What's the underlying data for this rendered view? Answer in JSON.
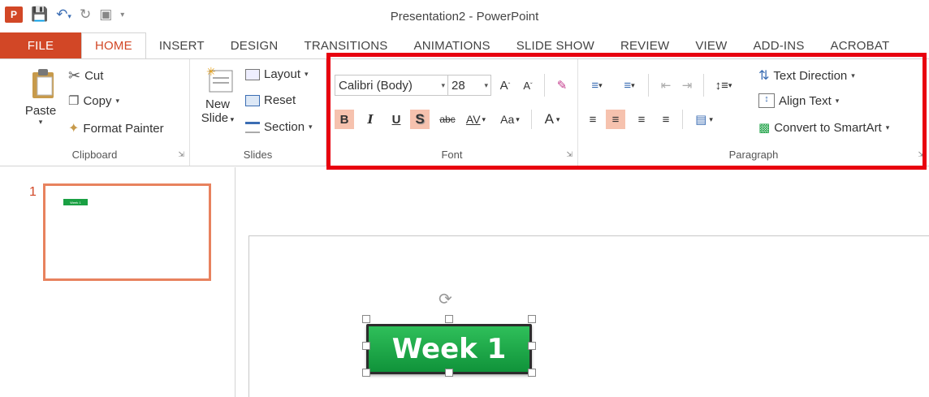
{
  "window": {
    "title": "Presentation2 - PowerPoint"
  },
  "qat": {
    "logo": "P",
    "save_icon": "save-icon",
    "undo_icon": "undo-icon",
    "redo_icon": "redo-icon",
    "present_icon": "presentation-icon"
  },
  "tabs": [
    "FILE",
    "HOME",
    "INSERT",
    "DESIGN",
    "TRANSITIONS",
    "ANIMATIONS",
    "SLIDE SHOW",
    "REVIEW",
    "VIEW",
    "ADD-INS",
    "ACROBAT"
  ],
  "active_tab": "HOME",
  "clipboard": {
    "paste_label": "Paste",
    "cut_label": "Cut",
    "copy_label": "Copy",
    "format_painter_label": "Format Painter",
    "group_label": "Clipboard"
  },
  "slides": {
    "new_slide_label_1": "New",
    "new_slide_label_2": "Slide",
    "layout_label": "Layout",
    "reset_label": "Reset",
    "section_label": "Section",
    "group_label": "Slides"
  },
  "font": {
    "font_name": "Calibri (Body)",
    "font_size": "28",
    "grow_label": "A",
    "shrink_label": "A",
    "bold_label": "B",
    "italic_label": "I",
    "underline_label": "U",
    "shadow_label": "S",
    "strike_label": "abc",
    "spacing_label": "AV",
    "case_label": "Aa",
    "color_label": "A",
    "group_label": "Font"
  },
  "paragraph": {
    "text_direction_label": "Text Direction",
    "align_text_label": "Align Text",
    "smartart_label": "Convert to SmartArt",
    "group_label": "Paragraph"
  },
  "slide_pane": {
    "number": "1",
    "thumb_text": "Week 1"
  },
  "canvas": {
    "shape_text": "Week 1"
  },
  "colors": {
    "accent": "#d24726",
    "highlight": "#e8000f",
    "shape_green": "#1aa043",
    "toggle_on": "#f6c2ae"
  }
}
